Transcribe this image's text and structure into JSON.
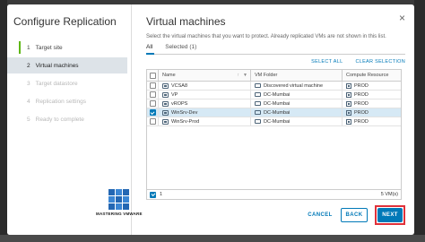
{
  "wizard": {
    "title": "Configure Replication",
    "steps": [
      {
        "num": "1",
        "label": "Target site",
        "state": "done"
      },
      {
        "num": "2",
        "label": "Virtual machines",
        "state": "active"
      },
      {
        "num": "3",
        "label": "Target datastore",
        "state": "disabled"
      },
      {
        "num": "4",
        "label": "Replication settings",
        "state": "disabled"
      },
      {
        "num": "5",
        "label": "Ready to complete",
        "state": "disabled"
      }
    ]
  },
  "logo": {
    "text": "MASTERING VMWARE"
  },
  "page": {
    "title": "Virtual machines",
    "subtitle": "Select the virtual machines that you want to protect. Already replicated VMs are not shown in this list.",
    "close_glyph": "×"
  },
  "tabs": [
    {
      "label": "All",
      "active": true
    },
    {
      "label": "Selected (1)",
      "active": false
    }
  ],
  "grid": {
    "actions": {
      "select_all": "SELECT ALL",
      "clear_selection": "CLEAR SELECTION"
    },
    "columns": {
      "name": "Name",
      "folder": "VM Folder",
      "resource": "Compute Resource"
    },
    "sort_icons": {
      "sort": "↑",
      "filter": "▼"
    },
    "rows": [
      {
        "name": "VCSA8",
        "folder": "Discovered virtual machine",
        "resource": "PROD",
        "checked": false
      },
      {
        "name": "VP",
        "folder": "DC-Mumbai",
        "resource": "PROD",
        "checked": false
      },
      {
        "name": "vROPS",
        "folder": "DC-Mumbai",
        "resource": "PROD",
        "checked": false
      },
      {
        "name": "WinSrv-Dev",
        "folder": "DC-Mumbai",
        "resource": "PROD",
        "checked": true
      },
      {
        "name": "WinSrv-Prod",
        "folder": "DC-Mumbai",
        "resource": "PROD",
        "checked": false
      }
    ],
    "footer": {
      "selected_count": "1",
      "total": "5 VM(s)"
    }
  },
  "buttons": {
    "cancel": "CANCEL",
    "back": "BACK",
    "next": "NEXT"
  },
  "colors": {
    "accent": "#0079b8",
    "highlight": "#e0313a",
    "done": "#5eb715"
  }
}
